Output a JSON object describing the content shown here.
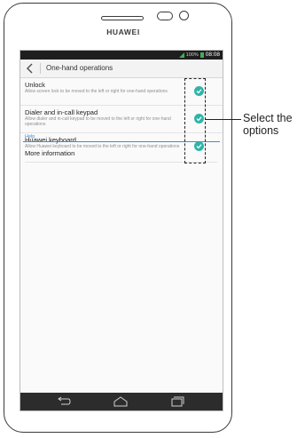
{
  "device": {
    "brand": "HUAWEI"
  },
  "status_bar": {
    "battery_pct": "100%",
    "time": "08:08"
  },
  "header": {
    "title": "One-hand operations"
  },
  "items": [
    {
      "title": "Unlock",
      "desc": "Allow screen lock to be moved to the left or right for one-hand operations",
      "checked": true
    },
    {
      "title": "Dialer and in-call keypad",
      "desc": "Allow dialer and in-call keypad to be moved to the left or right for one-hand operations",
      "checked": true
    },
    {
      "title": "Huawei keyboard",
      "desc": "Allow Huawei keyboard to be moved to the left or right for one-hand operations",
      "checked": true
    }
  ],
  "help": {
    "header": "Help",
    "more_info": "More information"
  },
  "callout": {
    "text": "Select the options"
  },
  "colors": {
    "accent": "#2fb4a7",
    "help_blue": "#3c8fd6",
    "status_green": "#3fae5a"
  },
  "icons": {
    "back": "chevron-left-icon",
    "check": "check-circle-icon",
    "nav_back": "back-arrow-icon",
    "nav_home": "home-icon",
    "nav_recent": "recent-apps-icon"
  }
}
